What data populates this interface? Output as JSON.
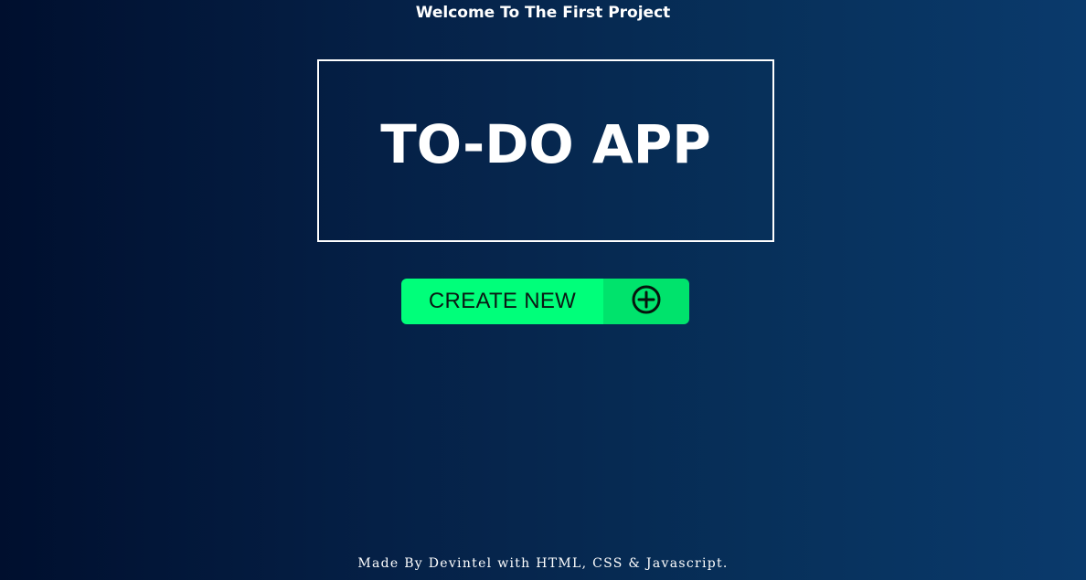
{
  "header": {
    "welcome_text": "Welcome To The First Project"
  },
  "title_box": {
    "title": "TO-DO APP"
  },
  "create_button": {
    "label": "CREATE NEW",
    "icon": "plus-circle-icon"
  },
  "footer": {
    "text": "Made By Devintel with HTML, CSS & Javascript."
  },
  "colors": {
    "background_start": "#000f2e",
    "background_end": "#0a3a6c",
    "button_green": "#00ff7a",
    "button_icon_green": "#00e36c",
    "text": "#ffffff"
  }
}
